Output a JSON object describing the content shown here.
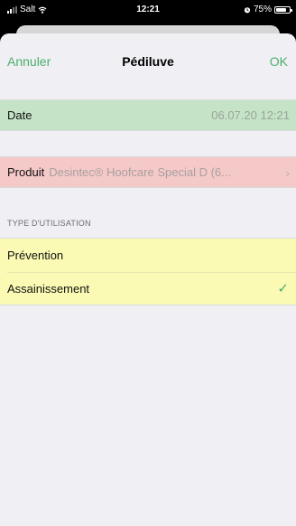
{
  "status_bar": {
    "carrier": "Salt",
    "time": "12:21",
    "battery_percent": "75%",
    "icons": [
      "signal-icon",
      "wifi-icon",
      "alarm-icon",
      "battery-icon"
    ]
  },
  "nav": {
    "cancel_label": "Annuler",
    "title": "Pédiluve",
    "ok_label": "OK"
  },
  "form": {
    "date": {
      "label": "Date",
      "value": "06.07.20 12:21"
    },
    "product": {
      "label": "Produit",
      "value": "Desintec® Hoofcare Special D (6...",
      "chevron": "›"
    },
    "usage_section": {
      "header": "TYPE D'UTILISATION",
      "options": [
        {
          "label": "Prévention",
          "selected": false
        },
        {
          "label": "Assainissement",
          "selected": true
        }
      ],
      "check_glyph": "✓"
    }
  },
  "colors": {
    "accent": "#4caf6a",
    "date_row_bg": "#c5e4c7",
    "product_row_bg": "#f6c9c9",
    "usage_group_bg": "#fafab4",
    "sheet_bg": "#efeff4"
  }
}
